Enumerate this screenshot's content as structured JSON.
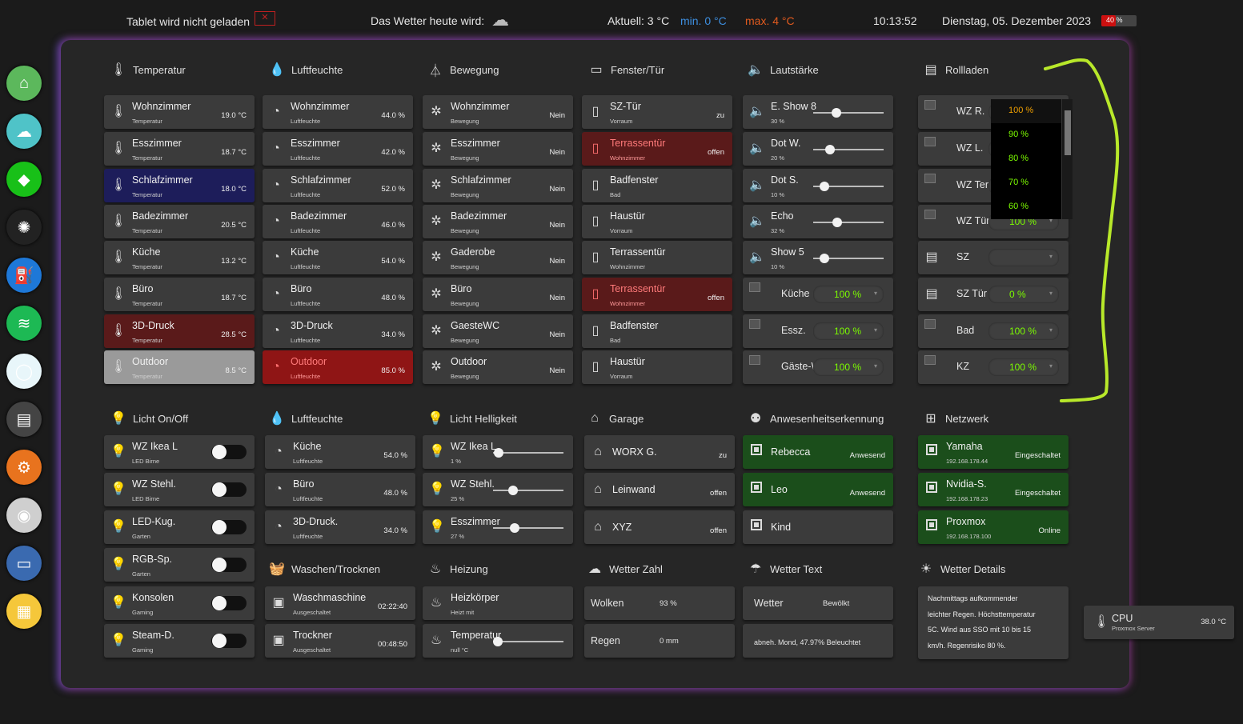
{
  "topbar": {
    "charging": "Tablet wird nicht geladen",
    "weather_label": "Das Wetter heute wird:",
    "current_temp": "Aktuell: 3 °C",
    "min_temp": "min. 0 °C",
    "max_temp": "max. 4 °C",
    "time": "10:13:52",
    "date": "Dienstag, 05. Dezember 2023",
    "battery_label": "40 %",
    "battery_level": 0.4,
    "colors": {
      "min": "#3d8fe0",
      "max": "#e05a1e",
      "battery": "#cc1010"
    }
  },
  "sidebar": [
    {
      "name": "home-icon",
      "color": "#5cb85c",
      "glyph": "⌂"
    },
    {
      "name": "cloud-icon",
      "color": "#4fc3c8",
      "glyph": "☁"
    },
    {
      "name": "vacuum-robot-icon",
      "color": "#18c018",
      "glyph": "◆"
    },
    {
      "name": "yamaha-icon",
      "color": "#222222",
      "glyph": "✺"
    },
    {
      "name": "fuel-pump-icon",
      "color": "#1e78d8",
      "glyph": "⛽"
    },
    {
      "name": "spotify-icon",
      "color": "#1db954",
      "glyph": "≋"
    },
    {
      "name": "alexa-icon",
      "color": "#e8f6fa",
      "glyph": "◯"
    },
    {
      "name": "server-icon",
      "color": "#444444",
      "glyph": "▤"
    },
    {
      "name": "settings-icon",
      "color": "#e8731e",
      "glyph": "⚙"
    },
    {
      "name": "webcam-icon",
      "color": "#cfcfcf",
      "glyph": "◉"
    },
    {
      "name": "tablet-icon",
      "color": "#3a6ab0",
      "glyph": "▭"
    },
    {
      "name": "notes-icon",
      "color": "#f5c73a",
      "glyph": "▦"
    }
  ],
  "sections": {
    "temperatur": "Temperatur",
    "luftfeuchte": "Luftfeuchte",
    "bewegung": "Bewegung",
    "fenster": "Fenster/Tür",
    "lautstaerke": "Lautstärke",
    "rollladen": "Rollladen",
    "licht": "Licht On/Off",
    "luftfeuchte2": "Luftfeuchte",
    "helligkeit": "Licht Helligkeit",
    "garage": "Garage",
    "anwesenheit": "Anwesenheitserkennung",
    "netzwerk": "Netzwerk",
    "waschen": "Waschen/Trocknen",
    "heizung": "Heizung",
    "wetterzahl": "Wetter Zahl",
    "wettertext": "Wetter Text",
    "wetterdetails": "Wetter Details"
  },
  "temperatur": [
    {
      "name": "Wohnzimmer",
      "sub": "Temperatur",
      "val": "19.0 °C",
      "style": ""
    },
    {
      "name": "Esszimmer",
      "sub": "Temperatur",
      "val": "18.7 °C",
      "style": ""
    },
    {
      "name": "Schlafzimmer",
      "sub": "Temperatur",
      "val": "18.0 °C",
      "style": "bluebg"
    },
    {
      "name": "Badezimmer",
      "sub": "Temperatur",
      "val": "20.5 °C",
      "style": ""
    },
    {
      "name": "Küche",
      "sub": "Temperatur",
      "val": "13.2 °C",
      "style": ""
    },
    {
      "name": "Büro",
      "sub": "Temperatur",
      "val": "18.7 °C",
      "style": ""
    },
    {
      "name": "3D-Druck",
      "sub": "Temperatur",
      "val": "28.5 °C",
      "style": "redbg"
    },
    {
      "name": "Outdoor",
      "sub": "Temperatur",
      "val": "8.5 °C",
      "style": "grey"
    }
  ],
  "luftfeuchte": [
    {
      "name": "Wohnzimmer",
      "sub": "Luftfeuchte",
      "val": "44.0 %",
      "style": ""
    },
    {
      "name": "Esszimmer",
      "sub": "Luftfeuchte",
      "val": "42.0 %",
      "style": ""
    },
    {
      "name": "Schlafzimmer",
      "sub": "Luftfeuchte",
      "val": "52.0 %",
      "style": ""
    },
    {
      "name": "Badezimmer",
      "sub": "Luftfeuchte",
      "val": "46.0 %",
      "style": ""
    },
    {
      "name": "Küche",
      "sub": "Luftfeuchte",
      "val": "54.0 %",
      "style": ""
    },
    {
      "name": "Büro",
      "sub": "Luftfeuchte",
      "val": "48.0 %",
      "style": ""
    },
    {
      "name": "3D-Druck",
      "sub": "Luftfeuchte",
      "val": "34.0 %",
      "style": ""
    },
    {
      "name": "Outdoor",
      "sub": "Luftfeuchte",
      "val": "85.0 %",
      "style": "brightred"
    }
  ],
  "bewegung": [
    {
      "name": "Wohnzimmer",
      "sub": "Bewegung",
      "val": "Nein"
    },
    {
      "name": "Esszimmer",
      "sub": "Bewegung",
      "val": "Nein"
    },
    {
      "name": "Schlafzimmer",
      "sub": "Bewegung",
      "val": "Nein"
    },
    {
      "name": "Badezimmer",
      "sub": "Bewegung",
      "val": "Nein"
    },
    {
      "name": "Gaderobe",
      "sub": "Bewegung",
      "val": "Nein"
    },
    {
      "name": "Büro",
      "sub": "Bewegung",
      "val": "Nein"
    },
    {
      "name": "GaesteWC",
      "sub": "Bewegung",
      "val": "Nein"
    },
    {
      "name": "Outdoor",
      "sub": "Bewegung",
      "val": "Nein"
    }
  ],
  "fenster": [
    {
      "name": "SZ-Tür",
      "sub": "Vorraum",
      "val": "zu",
      "style": ""
    },
    {
      "name": "Terrassentür",
      "sub": "Wohnzimmer",
      "val": "offen",
      "style": "redbg"
    },
    {
      "name": "Badfenster",
      "sub": "Bad",
      "val": "",
      "style": ""
    },
    {
      "name": "Haustür",
      "sub": "Vorraum",
      "val": "",
      "style": ""
    },
    {
      "name": "Terrassentür",
      "sub": "Wohnzimmer",
      "val": "",
      "style": ""
    },
    {
      "name": "Terrassentür",
      "sub": "Wohnzimmer",
      "val": "offen",
      "style": "redbg"
    },
    {
      "name": "Badfenster",
      "sub": "Bad",
      "val": "",
      "style": ""
    },
    {
      "name": "Haustür",
      "sub": "Vorraum",
      "val": "",
      "style": ""
    }
  ],
  "lautstaerke": [
    {
      "name": "E. Show 8",
      "sub": "30 %",
      "level": 0.3
    },
    {
      "name": "Dot W.",
      "sub": "20 %",
      "level": 0.2
    },
    {
      "name": "Dot S.",
      "sub": "10 %",
      "level": 0.1
    },
    {
      "name": "Echo",
      "sub": "32 %",
      "level": 0.32
    },
    {
      "name": "Show 5",
      "sub": "10 %",
      "level": 0.1
    }
  ],
  "cover_vol": [
    {
      "name": "Küche",
      "val": "100 %"
    },
    {
      "name": "Essz.",
      "val": "100 %"
    },
    {
      "name": "Gäste-WC",
      "val": "100 %"
    }
  ],
  "rollladen": [
    {
      "name": "WZ R.",
      "val": ""
    },
    {
      "name": "WZ L.",
      "val": ""
    },
    {
      "name": "WZ Ter.",
      "val": ""
    },
    {
      "name": "WZ Tür",
      "val": "100 %"
    },
    {
      "name": "SZ",
      "val": ""
    },
    {
      "name": "SZ Tür",
      "val": "0 %"
    },
    {
      "name": "Bad",
      "val": "100 %"
    },
    {
      "name": "KZ",
      "val": "100 %"
    }
  ],
  "dropdown_options": [
    "100 %",
    "90 %",
    "80 %",
    "70 %",
    "60 %"
  ],
  "licht": [
    {
      "name": "WZ Ikea L",
      "sub": "LED Birne"
    },
    {
      "name": "WZ Stehl.",
      "sub": "LED Birne"
    },
    {
      "name": "LED-Kug.",
      "sub": "Garten"
    },
    {
      "name": "RGB-Sp.",
      "sub": "Garten"
    },
    {
      "name": "Konsolen",
      "sub": "Gaming"
    },
    {
      "name": "Steam-D.",
      "sub": "Gaming"
    }
  ],
  "luftfeuchte2": [
    {
      "name": "Küche",
      "sub": "Luftfeuchte",
      "val": "54.0 %"
    },
    {
      "name": "Büro",
      "sub": "Luftfeuchte",
      "val": "48.0 %"
    },
    {
      "name": "3D-Druck.",
      "sub": "Luftfeuchte",
      "val": "34.0 %"
    }
  ],
  "helligkeit": [
    {
      "name": "WZ Ikea L",
      "sub": "1 %",
      "level": 0.01
    },
    {
      "name": "WZ Stehl.",
      "sub": "25 %",
      "level": 0.25
    },
    {
      "name": "Esszimmer",
      "sub": "27 %",
      "level": 0.27
    }
  ],
  "garage": [
    {
      "name": "WORX G.",
      "val": "zu"
    },
    {
      "name": "Leinwand",
      "val": "offen"
    },
    {
      "name": "XYZ",
      "val": "offen"
    }
  ],
  "anwesenheit": [
    {
      "name": "Rebecca",
      "val": "Anwesend",
      "style": "green"
    },
    {
      "name": "Leo",
      "val": "Anwesend",
      "style": "green"
    },
    {
      "name": "Kind",
      "val": "",
      "style": ""
    }
  ],
  "netzwerk": [
    {
      "name": "Yamaha",
      "sub": "192.168.178.44",
      "val": "Eingeschaltet"
    },
    {
      "name": "Nvidia-S.",
      "sub": "192.168.178.23",
      "val": "Eingeschaltet"
    },
    {
      "name": "Proxmox",
      "sub": "192.168.178.100",
      "val": "Online"
    }
  ],
  "waschen": [
    {
      "name": "Waschmaschine",
      "sub": "Ausgeschaltet",
      "val": "02:22:40"
    },
    {
      "name": "Trockner",
      "sub": "Ausgeschaltet",
      "val": "00:48:50"
    }
  ],
  "heizung": [
    {
      "name": "Heizkörper",
      "sub": "Heizt mit"
    },
    {
      "name": "Temperatur",
      "sub": "null °C"
    }
  ],
  "wetterzahl": [
    {
      "name": "Wolken",
      "val": "93 %"
    },
    {
      "name": "Regen",
      "val": "0 mm"
    }
  ],
  "wettertext": [
    {
      "name": "Wetter",
      "val": "Bewölkt"
    },
    {
      "name": "abneh. Mond, 47.97% Beleuchtet"
    }
  ],
  "wetterdetails": [
    "Nachmittags aufkommender",
    "leichter Regen. Höchsttemperatur",
    "5C. Wind aus SSO mit 10 bis 15",
    "km/h. Regenrisiko 80 %."
  ],
  "cpu": {
    "name": "CPU",
    "sub": "Proxmox Server",
    "val": "38.0 °C"
  }
}
